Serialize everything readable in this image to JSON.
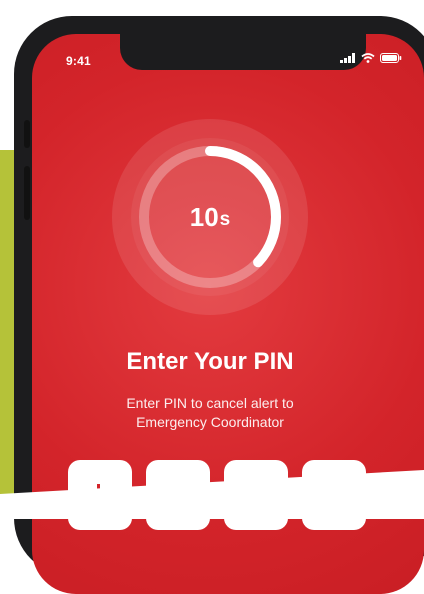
{
  "status_bar": {
    "time": "9:41",
    "icons": [
      "signal-icon",
      "wifi-icon",
      "battery-icon"
    ]
  },
  "timer": {
    "value": "10",
    "unit": "s",
    "progress": 0.37
  },
  "pin_screen": {
    "title": "Enter Your PIN",
    "subtitle_line1": "Enter PIN to cancel alert to",
    "subtitle_line2": "Emergency Coordinator"
  },
  "pin_fields": [
    {
      "name": "pin-digit-1"
    },
    {
      "name": "pin-digit-2"
    },
    {
      "name": "pin-digit-3"
    },
    {
      "name": "pin-digit-4"
    }
  ],
  "colors": {
    "accent_red": "#d3242a",
    "frame": "#1c1c1e",
    "side_strip": "#b5c239"
  }
}
